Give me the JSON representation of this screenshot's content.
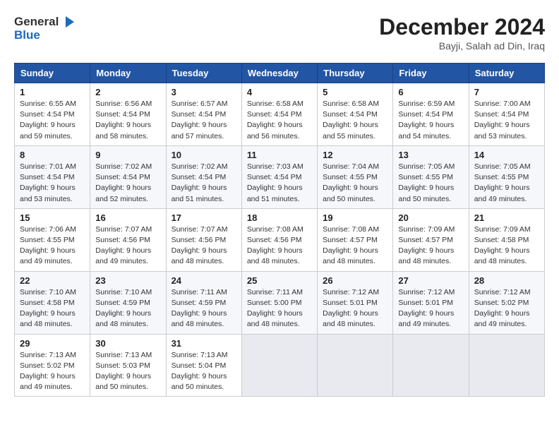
{
  "header": {
    "logo_line1": "General",
    "logo_line2": "Blue",
    "title": "December 2024",
    "subtitle": "Bayji, Salah ad Din, Iraq"
  },
  "calendar": {
    "days_of_week": [
      "Sunday",
      "Monday",
      "Tuesday",
      "Wednesday",
      "Thursday",
      "Friday",
      "Saturday"
    ],
    "weeks": [
      [
        null,
        {
          "day": "2",
          "sunrise": "6:56 AM",
          "sunset": "4:54 PM",
          "daylight": "9 hours and 58 minutes."
        },
        {
          "day": "3",
          "sunrise": "6:57 AM",
          "sunset": "4:54 PM",
          "daylight": "9 hours and 57 minutes."
        },
        {
          "day": "4",
          "sunrise": "6:58 AM",
          "sunset": "4:54 PM",
          "daylight": "9 hours and 56 minutes."
        },
        {
          "day": "5",
          "sunrise": "6:58 AM",
          "sunset": "4:54 PM",
          "daylight": "9 hours and 55 minutes."
        },
        {
          "day": "6",
          "sunrise": "6:59 AM",
          "sunset": "4:54 PM",
          "daylight": "9 hours and 54 minutes."
        },
        {
          "day": "7",
          "sunrise": "7:00 AM",
          "sunset": "4:54 PM",
          "daylight": "9 hours and 53 minutes."
        }
      ],
      [
        {
          "day": "1",
          "sunrise": "6:55 AM",
          "sunset": "4:54 PM",
          "daylight": "9 hours and 59 minutes."
        },
        {
          "day": "9",
          "sunrise": "7:02 AM",
          "sunset": "4:54 PM",
          "daylight": "9 hours and 52 minutes."
        },
        {
          "day": "10",
          "sunrise": "7:02 AM",
          "sunset": "4:54 PM",
          "daylight": "9 hours and 51 minutes."
        },
        {
          "day": "11",
          "sunrise": "7:03 AM",
          "sunset": "4:54 PM",
          "daylight": "9 hours and 51 minutes."
        },
        {
          "day": "12",
          "sunrise": "7:04 AM",
          "sunset": "4:55 PM",
          "daylight": "9 hours and 50 minutes."
        },
        {
          "day": "13",
          "sunrise": "7:05 AM",
          "sunset": "4:55 PM",
          "daylight": "9 hours and 50 minutes."
        },
        {
          "day": "14",
          "sunrise": "7:05 AM",
          "sunset": "4:55 PM",
          "daylight": "9 hours and 49 minutes."
        }
      ],
      [
        {
          "day": "8",
          "sunrise": "7:01 AM",
          "sunset": "4:54 PM",
          "daylight": "9 hours and 53 minutes."
        },
        {
          "day": "16",
          "sunrise": "7:07 AM",
          "sunset": "4:56 PM",
          "daylight": "9 hours and 49 minutes."
        },
        {
          "day": "17",
          "sunrise": "7:07 AM",
          "sunset": "4:56 PM",
          "daylight": "9 hours and 48 minutes."
        },
        {
          "day": "18",
          "sunrise": "7:08 AM",
          "sunset": "4:56 PM",
          "daylight": "9 hours and 48 minutes."
        },
        {
          "day": "19",
          "sunrise": "7:08 AM",
          "sunset": "4:57 PM",
          "daylight": "9 hours and 48 minutes."
        },
        {
          "day": "20",
          "sunrise": "7:09 AM",
          "sunset": "4:57 PM",
          "daylight": "9 hours and 48 minutes."
        },
        {
          "day": "21",
          "sunrise": "7:09 AM",
          "sunset": "4:58 PM",
          "daylight": "9 hours and 48 minutes."
        }
      ],
      [
        {
          "day": "15",
          "sunrise": "7:06 AM",
          "sunset": "4:55 PM",
          "daylight": "9 hours and 49 minutes."
        },
        {
          "day": "23",
          "sunrise": "7:10 AM",
          "sunset": "4:59 PM",
          "daylight": "9 hours and 48 minutes."
        },
        {
          "day": "24",
          "sunrise": "7:11 AM",
          "sunset": "4:59 PM",
          "daylight": "9 hours and 48 minutes."
        },
        {
          "day": "25",
          "sunrise": "7:11 AM",
          "sunset": "5:00 PM",
          "daylight": "9 hours and 48 minutes."
        },
        {
          "day": "26",
          "sunrise": "7:12 AM",
          "sunset": "5:01 PM",
          "daylight": "9 hours and 48 minutes."
        },
        {
          "day": "27",
          "sunrise": "7:12 AM",
          "sunset": "5:01 PM",
          "daylight": "9 hours and 49 minutes."
        },
        {
          "day": "28",
          "sunrise": "7:12 AM",
          "sunset": "5:02 PM",
          "daylight": "9 hours and 49 minutes."
        }
      ],
      [
        {
          "day": "22",
          "sunrise": "7:10 AM",
          "sunset": "4:58 PM",
          "daylight": "9 hours and 48 minutes."
        },
        {
          "day": "30",
          "sunrise": "7:13 AM",
          "sunset": "5:03 PM",
          "daylight": "9 hours and 50 minutes."
        },
        {
          "day": "31",
          "sunrise": "7:13 AM",
          "sunset": "5:04 PM",
          "daylight": "9 hours and 50 minutes."
        },
        null,
        null,
        null,
        null
      ],
      [
        {
          "day": "29",
          "sunrise": "7:13 AM",
          "sunset": "5:02 PM",
          "daylight": "9 hours and 49 minutes."
        },
        null,
        null,
        null,
        null,
        null,
        null
      ]
    ]
  }
}
